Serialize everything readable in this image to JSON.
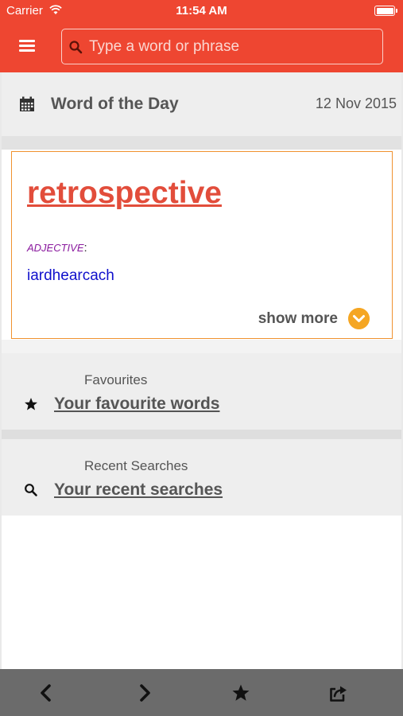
{
  "status_bar": {
    "carrier": "Carrier",
    "time": "11:54 AM",
    "wifi_icon": "wifi-icon",
    "battery_icon": "battery-icon"
  },
  "header": {
    "menu_icon": "hamburger-menu-icon",
    "search": {
      "icon": "search-icon",
      "placeholder": "Type a word or phrase",
      "value": ""
    }
  },
  "word_of_day": {
    "icon": "calendar-icon",
    "title": "Word of the Day",
    "date": "12 Nov 2015",
    "word": "retrospective",
    "part_of_speech": "ADJECTIVE",
    "colon": ":",
    "translation": "iardhearcach",
    "show_more_label": "show more",
    "show_more_icon": "chevron-down-circle-icon"
  },
  "favourites": {
    "heading": "Favourites",
    "icon": "star-icon",
    "link": "Your favourite words"
  },
  "recent_searches": {
    "heading": "Recent Searches",
    "icon": "search-icon",
    "link": "Your recent searches"
  },
  "toolbar": {
    "items": [
      "back-icon",
      "forward-icon",
      "star-icon",
      "share-icon"
    ]
  },
  "colors": {
    "brand": "#ee4631",
    "word": "#e24d3b",
    "card_border": "#f0922f",
    "show_more": "#f5a623",
    "part_of_speech": "#8a1a9e",
    "translation": "#1010cc",
    "toolbar": "#6b6b6b"
  }
}
